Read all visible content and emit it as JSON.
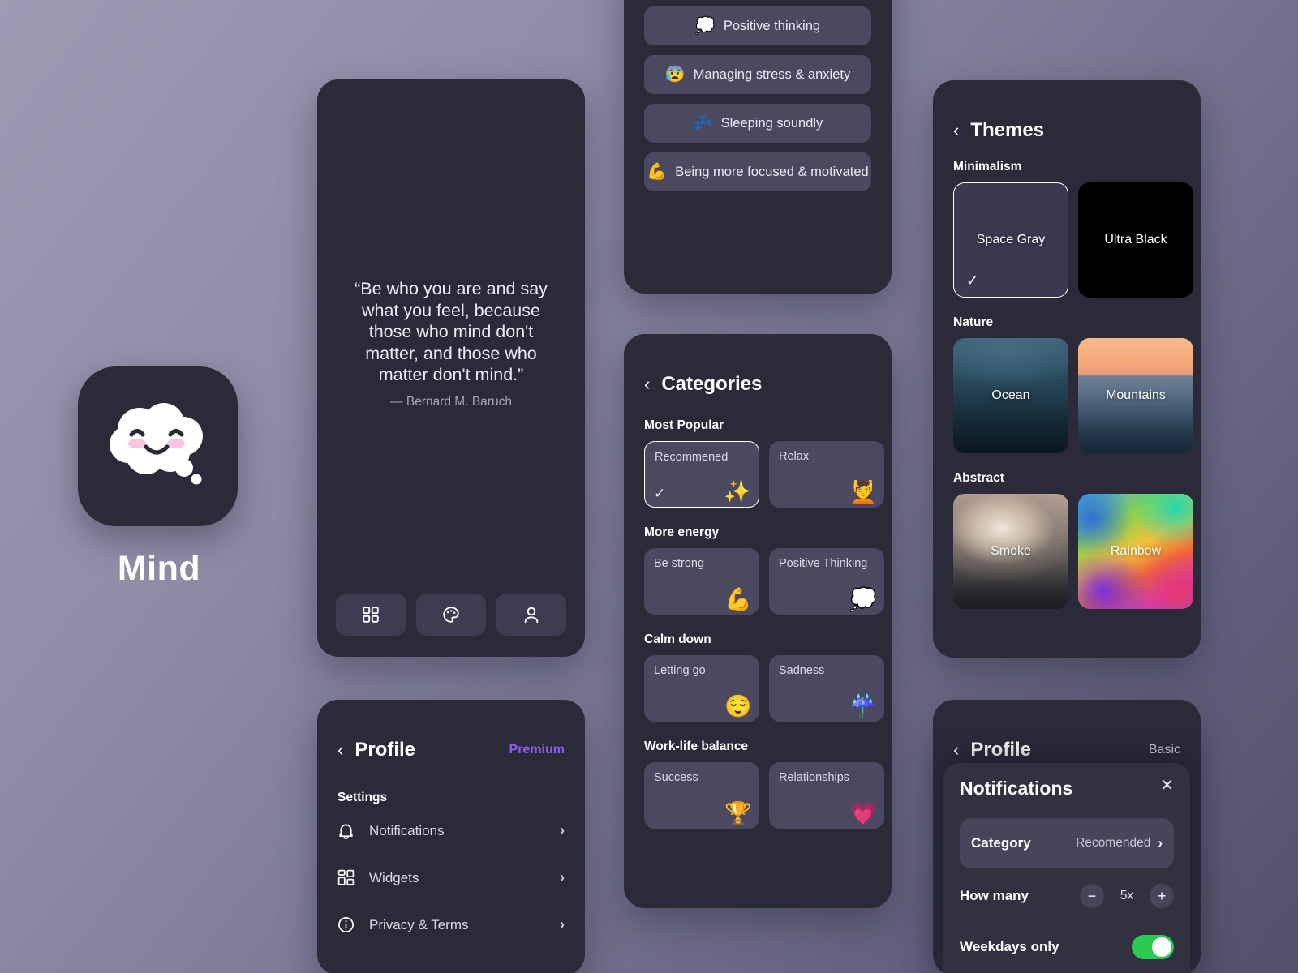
{
  "app": {
    "name": "Mind",
    "icon": "cloud-smiley-icon"
  },
  "quote_card": {
    "quote": "“Be who you are and say what you feel, because those who mind don't matter, and those who matter don't mind.”",
    "author": "— Bernard M. Baruch",
    "nav": [
      {
        "name": "grid-icon",
        "label": "Categories"
      },
      {
        "name": "palette-icon",
        "label": "Themes"
      },
      {
        "name": "person-icon",
        "label": "Profile"
      }
    ]
  },
  "topics_card": {
    "items": [
      {
        "emoji": "💭",
        "label": "Positive thinking"
      },
      {
        "emoji": "😰",
        "label": "Managing stress & anxiety"
      },
      {
        "emoji": "💤",
        "label": "Sleeping soundly"
      },
      {
        "emoji": "💪",
        "label": "Being more focused & motivated"
      }
    ]
  },
  "categories_card": {
    "title": "Categories",
    "back_icon": "chevron-left-icon",
    "groups": [
      {
        "title": "Most Popular",
        "tiles": [
          {
            "label": "Recommened",
            "emoji": "✨",
            "selected": true
          },
          {
            "label": "Relax",
            "emoji": "💆",
            "selected": false
          },
          {
            "label": "",
            "emoji": "",
            "selected": false
          }
        ]
      },
      {
        "title": "More energy",
        "tiles": [
          {
            "label": "Be strong",
            "emoji": "💪",
            "selected": false
          },
          {
            "label": "Positive Thinking",
            "emoji": "💭",
            "selected": false
          },
          {
            "label": "",
            "emoji": "",
            "selected": false
          }
        ]
      },
      {
        "title": "Calm down",
        "tiles": [
          {
            "label": "Letting go",
            "emoji": "😌",
            "selected": false
          },
          {
            "label": "Sadness",
            "emoji": "☔",
            "selected": false
          },
          {
            "label": "",
            "emoji": "",
            "selected": false
          }
        ]
      },
      {
        "title": "Work-life balance",
        "tiles": [
          {
            "label": "Success",
            "emoji": "🏆",
            "selected": false
          },
          {
            "label": "Relationships",
            "emoji": "💗",
            "selected": false
          },
          {
            "label": "",
            "emoji": "",
            "selected": false
          }
        ]
      }
    ]
  },
  "profile_card": {
    "title": "Profile",
    "back_icon": "chevron-left-icon",
    "plan": "Premium",
    "plan_color": "#8c5cf6",
    "settings_label": "Settings",
    "rows": [
      {
        "icon": "bell-icon",
        "label": "Notifications",
        "chevron": "›"
      },
      {
        "icon": "widgets-icon",
        "label": "Widgets",
        "chevron": "›"
      },
      {
        "icon": "info-icon",
        "label": "Privacy & Terms",
        "chevron": "›"
      }
    ]
  },
  "themes_card": {
    "title": "Themes",
    "back_icon": "chevron-left-icon",
    "groups": [
      {
        "title": "Minimalism",
        "tiles": [
          {
            "label": "Space Gray",
            "swatch": "sw-spacegray",
            "selected": true
          },
          {
            "label": "Ultra Black",
            "swatch": "sw-ultrablack",
            "selected": false
          },
          {
            "label": "",
            "swatch": "sw-blue",
            "selected": false
          }
        ]
      },
      {
        "title": "Nature",
        "tiles": [
          {
            "label": "Ocean",
            "swatch": "sw-ocean",
            "selected": false
          },
          {
            "label": "Mountains",
            "swatch": "sw-mountains",
            "selected": false
          },
          {
            "label": "",
            "swatch": "sw-naturedark",
            "selected": false
          }
        ]
      },
      {
        "title": "Abstract",
        "tiles": [
          {
            "label": "Smoke",
            "swatch": "sw-smoke",
            "selected": false
          },
          {
            "label": "Rainbow",
            "swatch": "sw-rainbow",
            "selected": false
          },
          {
            "label": "",
            "swatch": "sw-teal",
            "selected": false
          }
        ]
      }
    ]
  },
  "profile_card_2": {
    "title": "Profile",
    "back_icon": "chevron-left-icon",
    "plan": "Basic"
  },
  "notifications_sheet": {
    "title": "Notifications",
    "close_icon": "close-icon",
    "category": {
      "label": "Category",
      "value": "Recomended",
      "chevron": "›"
    },
    "how_many": {
      "label": "How many",
      "minus": "−",
      "value": "5x",
      "plus": "+"
    },
    "weekdays_only": {
      "label": "Weekdays only",
      "enabled": true
    }
  }
}
